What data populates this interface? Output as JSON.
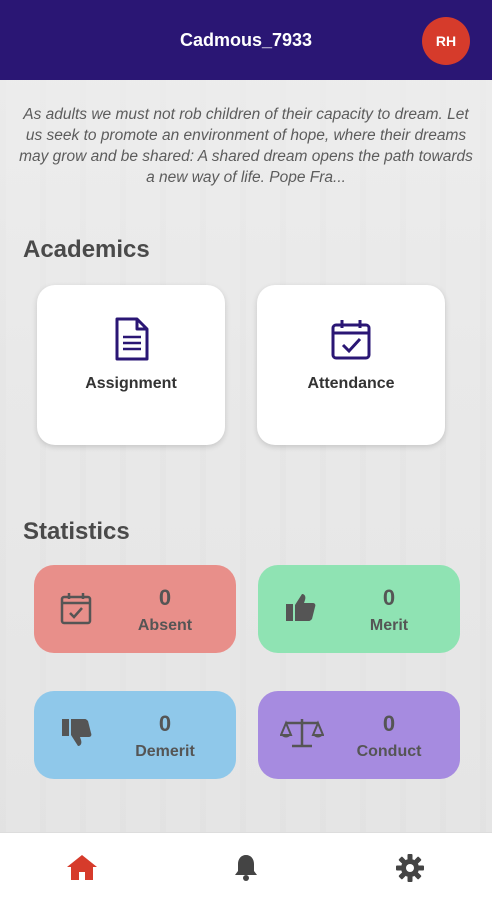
{
  "header": {
    "title": "Cadmous_7933",
    "avatar_initials": "RH"
  },
  "quote": "As adults we must not rob children of their capacity to dream. Let us seek to promote an environment of hope, where their dreams may grow and be shared: A shared dream opens the path towards a new way of life. Pope Fra...",
  "academics": {
    "title": "Academics",
    "items": [
      {
        "label": "Assignment",
        "icon": "document-icon"
      },
      {
        "label": "Attendance",
        "icon": "calendar-check-icon"
      }
    ]
  },
  "statistics": {
    "title": "Statistics",
    "items": [
      {
        "label": "Absent",
        "value": "0",
        "color": "#e88f8a",
        "icon": "calendar-check-icon"
      },
      {
        "label": "Merit",
        "value": "0",
        "color": "#8fe3b3",
        "icon": "thumbs-up-icon"
      },
      {
        "label": "Demerit",
        "value": "0",
        "color": "#8fc8ea",
        "icon": "thumbs-down-icon"
      },
      {
        "label": "Conduct",
        "value": "0",
        "color": "#a68be0",
        "icon": "scale-icon"
      }
    ]
  },
  "bottom_nav": {
    "items": [
      {
        "icon": "home-icon",
        "active": true
      },
      {
        "icon": "bell-icon",
        "active": false
      },
      {
        "icon": "gear-icon",
        "active": false
      }
    ],
    "active_color": "#d63b2b",
    "inactive_color": "#444444"
  },
  "colors": {
    "brand": "#2a1674",
    "accent": "#d63b2b"
  }
}
